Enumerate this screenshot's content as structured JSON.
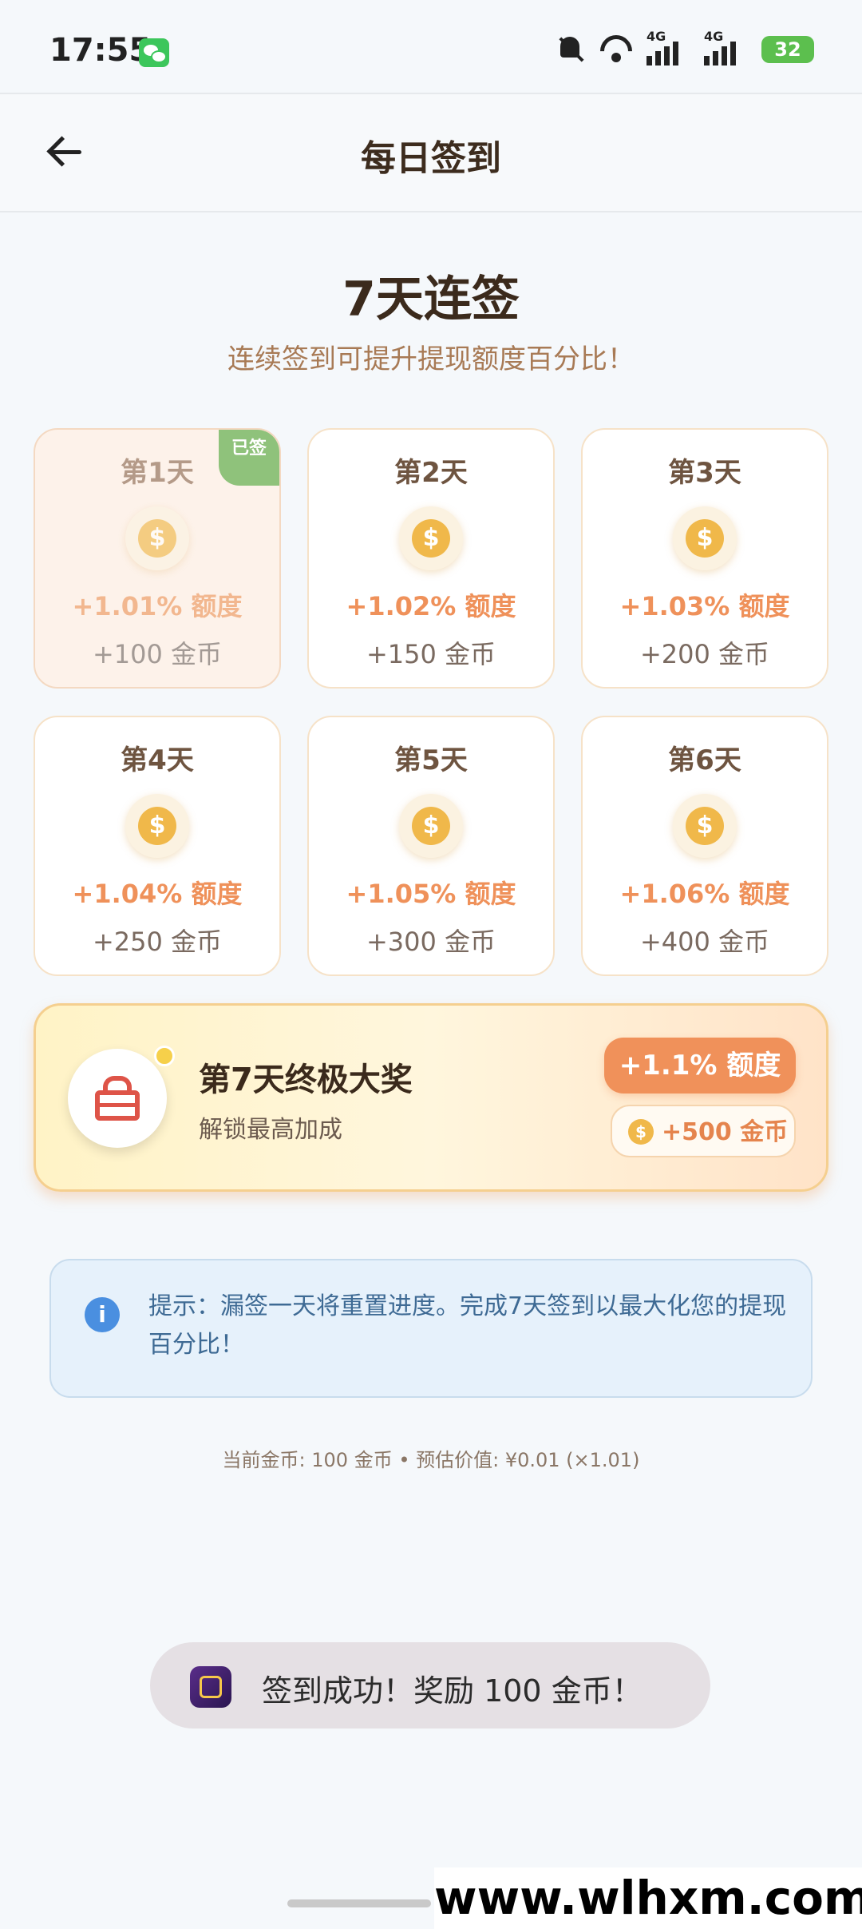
{
  "status_bar": {
    "time": "17:55",
    "battery": "32",
    "signal_label_1": "4G",
    "signal_label_2": "4G"
  },
  "header": {
    "title": "每日签到"
  },
  "hero": {
    "title": "7天连签",
    "subtitle": "连续签到可提升提现额度百分比！"
  },
  "days": [
    {
      "label": "第1天",
      "bonus": "+1.01% 额度",
      "coins": "+100 金币",
      "signed": true,
      "badge": "已签"
    },
    {
      "label": "第2天",
      "bonus": "+1.02% 额度",
      "coins": "+150 金币",
      "signed": false
    },
    {
      "label": "第3天",
      "bonus": "+1.03% 额度",
      "coins": "+200 金币",
      "signed": false
    },
    {
      "label": "第4天",
      "bonus": "+1.04% 额度",
      "coins": "+250 金币",
      "signed": false
    },
    {
      "label": "第5天",
      "bonus": "+1.05% 额度",
      "coins": "+300 金币",
      "signed": false
    },
    {
      "label": "第6天",
      "bonus": "+1.06% 额度",
      "coins": "+400 金币",
      "signed": false
    }
  ],
  "grand_prize": {
    "title": "第7天终极大奖",
    "subtitle": "解锁最高加成",
    "bonus": "+1.1% 额度",
    "coins": "+500 金币"
  },
  "tip": {
    "text": "提示：漏签一天将重置进度。完成7天签到以最大化您的提现百分比！"
  },
  "stats": {
    "text": "当前金币: 100 金币 • 预估价值: ¥0.01 (×1.01)"
  },
  "toast": {
    "text": "签到成功！奖励 100 金币！"
  },
  "watermark": {
    "text": "www.wlhxm.com"
  },
  "icons": {
    "coin": "$",
    "info": "i"
  },
  "colors": {
    "accent": "#f0915a",
    "signed_badge": "#8fc27b",
    "tip_bg": "#e6f1fb"
  }
}
